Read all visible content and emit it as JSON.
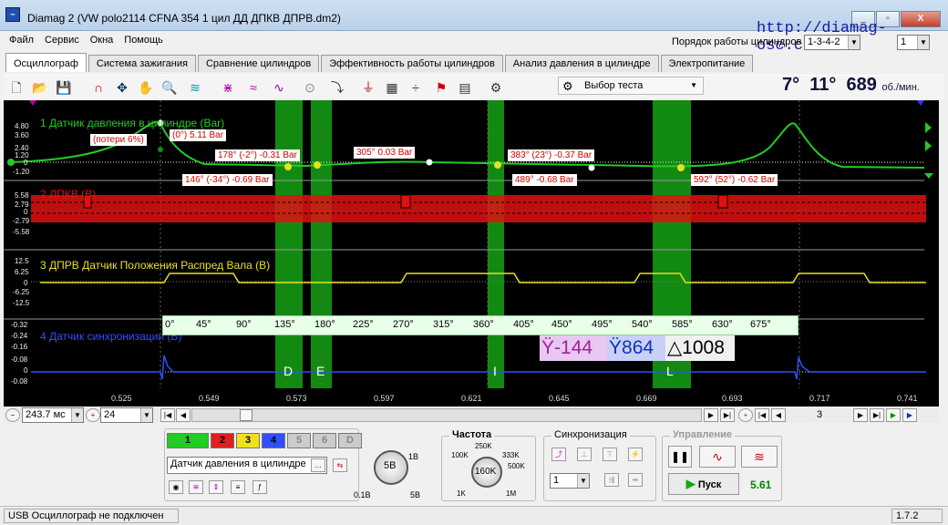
{
  "window": {
    "title": "Diamag 2 (VW polo2114 CFNA  354 1 цил ДД  ДПКВ ДПРВ.dm2)",
    "app_icon": "osc-icon",
    "website": "http://diamag-osc.com"
  },
  "menu": [
    "Файл",
    "Сервис",
    "Окна",
    "Помощь"
  ],
  "cylinder_order": {
    "label": "Порядок работы цилиндров",
    "value": "1-3-4-2",
    "cylinder": "1"
  },
  "tabs": [
    {
      "label": "Осциллограф",
      "active": true
    },
    {
      "label": "Система зажигания",
      "active": false
    },
    {
      "label": "Сравнение цилиндров",
      "active": false
    },
    {
      "label": "Эффективность работы цилиндров",
      "active": false
    },
    {
      "label": "Анализ давления в цилиндре",
      "active": false
    },
    {
      "label": "Электропитание",
      "active": false
    }
  ],
  "toolbar": {
    "test_select": "Выбор теста",
    "angle_a": "7°",
    "angle_b": "11°",
    "rpm": "689",
    "rpm_unit": "об./мин."
  },
  "channels": [
    {
      "label": "1 Датчик давления в цилиндре (Bar)",
      "color": "#22cc22",
      "ticks": [
        "4.80",
        "3.60",
        "2.40",
        "1.20",
        "0",
        "-1.20"
      ]
    },
    {
      "label": "2 ДПКВ (В)",
      "color": "#e01010",
      "ticks": [
        "5.58",
        "2.79",
        "0",
        "-2.79",
        "-5.58"
      ]
    },
    {
      "label": "3 ДПРВ Датчик Положения Распред Вала (В)",
      "color": "#e8e020",
      "ticks": [
        "12.5",
        "6.25",
        "0",
        "-6.25",
        "-12.5"
      ]
    },
    {
      "label": "4 Датчик синхронизации (В)",
      "color": "#3050ff",
      "ticks": [
        "-0.32",
        "-0.24",
        "-0.16",
        "-0.08",
        "0",
        "-0.08"
      ]
    }
  ],
  "annotations": {
    "loss": "(потери 6%)",
    "a0": "(0°) 5.11 Bar",
    "a178": "178° (-2°) -0.31 Bar",
    "a305": "305° 0.03 Bar",
    "a383": "383° (23°) -0.37 Bar",
    "a146": "146° (-34°) -0.69 Bar",
    "a489": "489° -0.68 Bar",
    "a592": "592° (52°) -0.62 Bar"
  },
  "angle_ruler": [
    "0°",
    "45°",
    "90°",
    "135°",
    "180°",
    "225°",
    "270°",
    "315°",
    "360°",
    "405°",
    "450°",
    "495°",
    "540°",
    "585°",
    "630°",
    "675°"
  ],
  "markers": [
    "D",
    "E",
    "I",
    "L"
  ],
  "cursors": {
    "a": "-144",
    "b": "864",
    "delta": "1008"
  },
  "time_axis": [
    "0.525",
    "0.549",
    "0.573",
    "0.597",
    "0.621",
    "0.645",
    "0.669",
    "0.693",
    "0.717",
    "0.741"
  ],
  "controls": {
    "time_scale": "243.7 мс",
    "zoom": "24",
    "frame": "3",
    "channel_buttons": [
      "1",
      "2",
      "3",
      "4",
      "5",
      "6",
      "D"
    ],
    "channel_name": "Датчик давления в цилиндре",
    "volt_knob": "5В",
    "volt_min": "0.1В",
    "volt_max": "5В",
    "volt_top": "1В",
    "freq_title": "Частота",
    "freq_value": "160K",
    "freq_labels": [
      "250K",
      "333K",
      "100K",
      "500K",
      "1K",
      "1M"
    ],
    "sync_title": "Синхронизация",
    "sync_value": "1",
    "control_title": "Управление",
    "start_label": "Пуск",
    "value": "5.61"
  },
  "status": {
    "left": "USB Осциллограф не подключен",
    "version": "1.7.2"
  }
}
